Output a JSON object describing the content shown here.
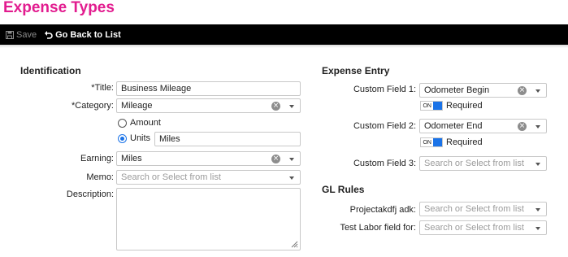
{
  "page": {
    "title": "Expense Types"
  },
  "toolbar": {
    "save_label": "Save",
    "back_label": "Go Back to List"
  },
  "identification": {
    "heading": "Identification",
    "title_label": "*Title:",
    "title_value": "Business Mileage",
    "category_label": "*Category:",
    "category_value": "Mileage",
    "amount_option": "Amount",
    "units_option": "Units",
    "units_value": "Miles",
    "earning_label": "Earning:",
    "earning_value": "Miles",
    "memo_label": "Memo:",
    "memo_placeholder": "Search or Select from list",
    "description_label": "Description:"
  },
  "expense_entry": {
    "heading": "Expense Entry",
    "cf1_label": "Custom Field 1:",
    "cf1_value": "Odometer Begin",
    "cf1_toggle": "ON",
    "cf1_required": "Required",
    "cf2_label": "Custom Field 2:",
    "cf2_value": "Odometer End",
    "cf2_toggle": "ON",
    "cf2_required": "Required",
    "cf3_label": "Custom Field 3:",
    "cf3_placeholder": "Search or Select from list"
  },
  "gl_rules": {
    "heading": "GL Rules",
    "project_label": "Projectakdfj adk:",
    "project_placeholder": "Search or Select from list",
    "labor_label": "Test Labor field for:",
    "labor_placeholder": "Search or Select from list"
  },
  "colors": {
    "title": "#e21c8f",
    "toolbar": "#000000",
    "accent": "#1a73e8"
  }
}
